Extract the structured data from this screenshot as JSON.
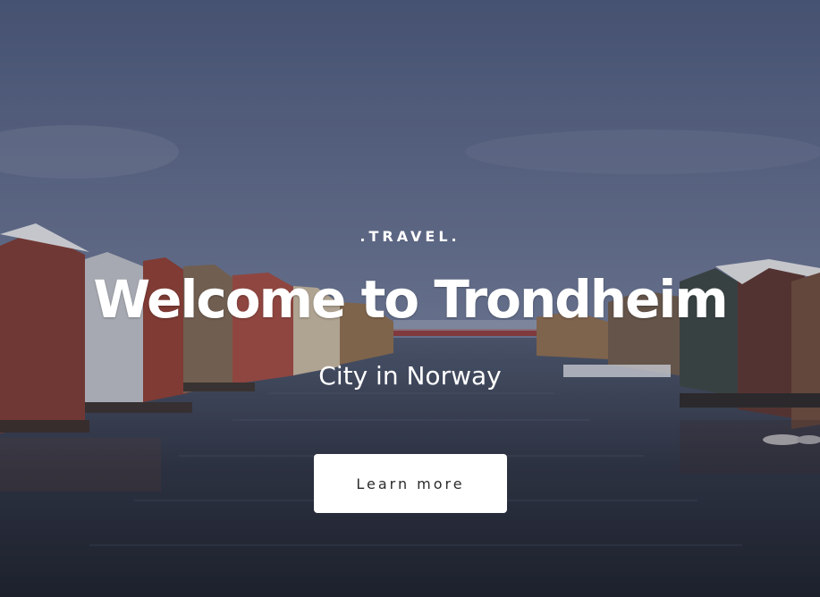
{
  "hero": {
    "eyebrow": ".TRAVEL.",
    "title": "Welcome to Trondheim",
    "subtitle": "City in Norway",
    "cta_label": "Learn more"
  },
  "colors": {
    "sky_top": "#4b5777",
    "sky_bottom": "#6b7591",
    "water_top": "#4a5266",
    "water_bottom": "#20242e",
    "text": "#ffffff",
    "button_bg": "#ffffff",
    "button_text": "#2b2b2b"
  }
}
